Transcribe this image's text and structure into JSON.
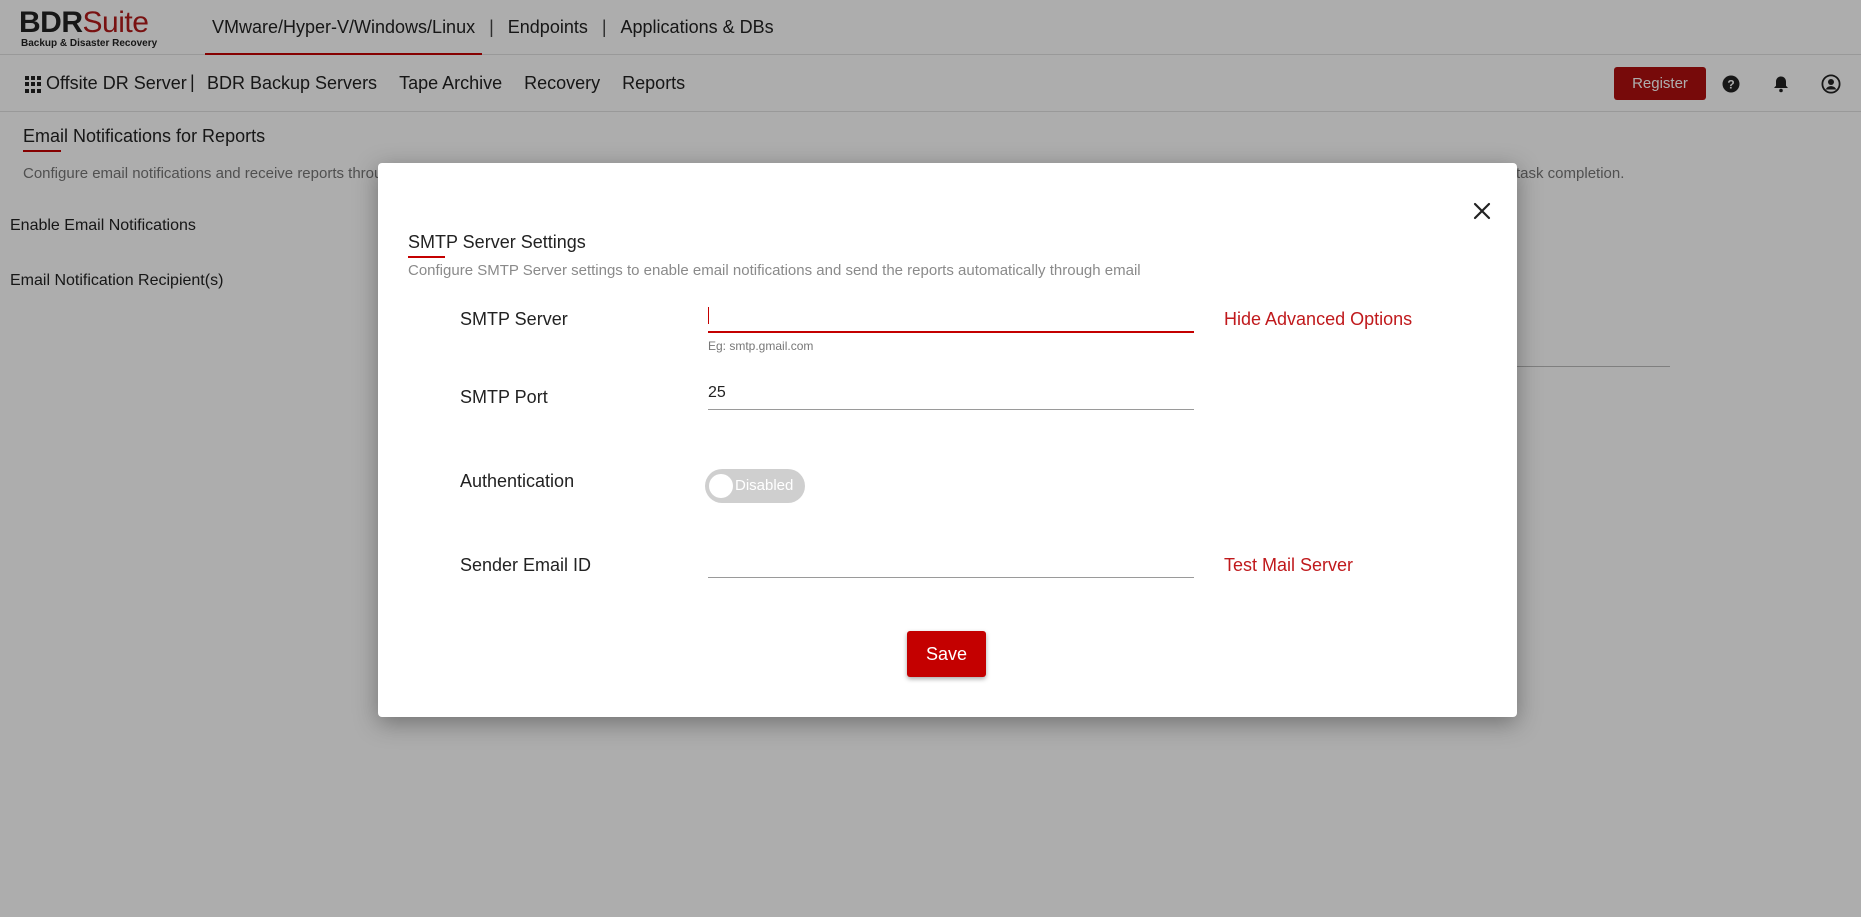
{
  "brand": {
    "logo_main": "BDR",
    "logo_accent": "Suite",
    "logo_sub": "Backup & Disaster Recovery"
  },
  "top_nav": {
    "items": [
      "VMware/Hyper-V/Windows/Linux",
      "Endpoints",
      "Applications & DBs"
    ],
    "separator": "|",
    "active_index": 0
  },
  "secondary_nav": {
    "product": "Offsite DR Server",
    "separator": "|",
    "items": [
      "BDR Backup Servers",
      "Tape Archive",
      "Recovery",
      "Reports"
    ],
    "register_label": "Register",
    "icons": [
      "help-icon",
      "bell-icon",
      "user-account-icon"
    ]
  },
  "page": {
    "title": "Email Notifications for Reports",
    "description": "Configure email notifications and receive reports throu",
    "description_tail": "task completion.",
    "labels": [
      "Enable Email Notifications",
      "Email Notification Recipient(s)"
    ]
  },
  "modal": {
    "title": "SMTP Server Settings",
    "description": "Configure SMTP Server settings to enable email notifications and send the reports automatically through email",
    "smtp_server": {
      "label": "SMTP Server",
      "value": "",
      "hint": "Eg: smtp.gmail.com",
      "advanced_link": "Hide Advanced Options"
    },
    "smtp_port": {
      "label": "SMTP Port",
      "value": "25"
    },
    "authentication": {
      "label": "Authentication",
      "state_label": "Disabled",
      "enabled": false
    },
    "sender_email": {
      "label": "Sender Email ID",
      "value": "",
      "test_link": "Test Mail Server"
    },
    "save_label": "Save"
  },
  "colors": {
    "accent": "#c40000",
    "link": "#c0191c",
    "register_bg": "#b01010",
    "toggle_off": "#cfcfcf"
  }
}
